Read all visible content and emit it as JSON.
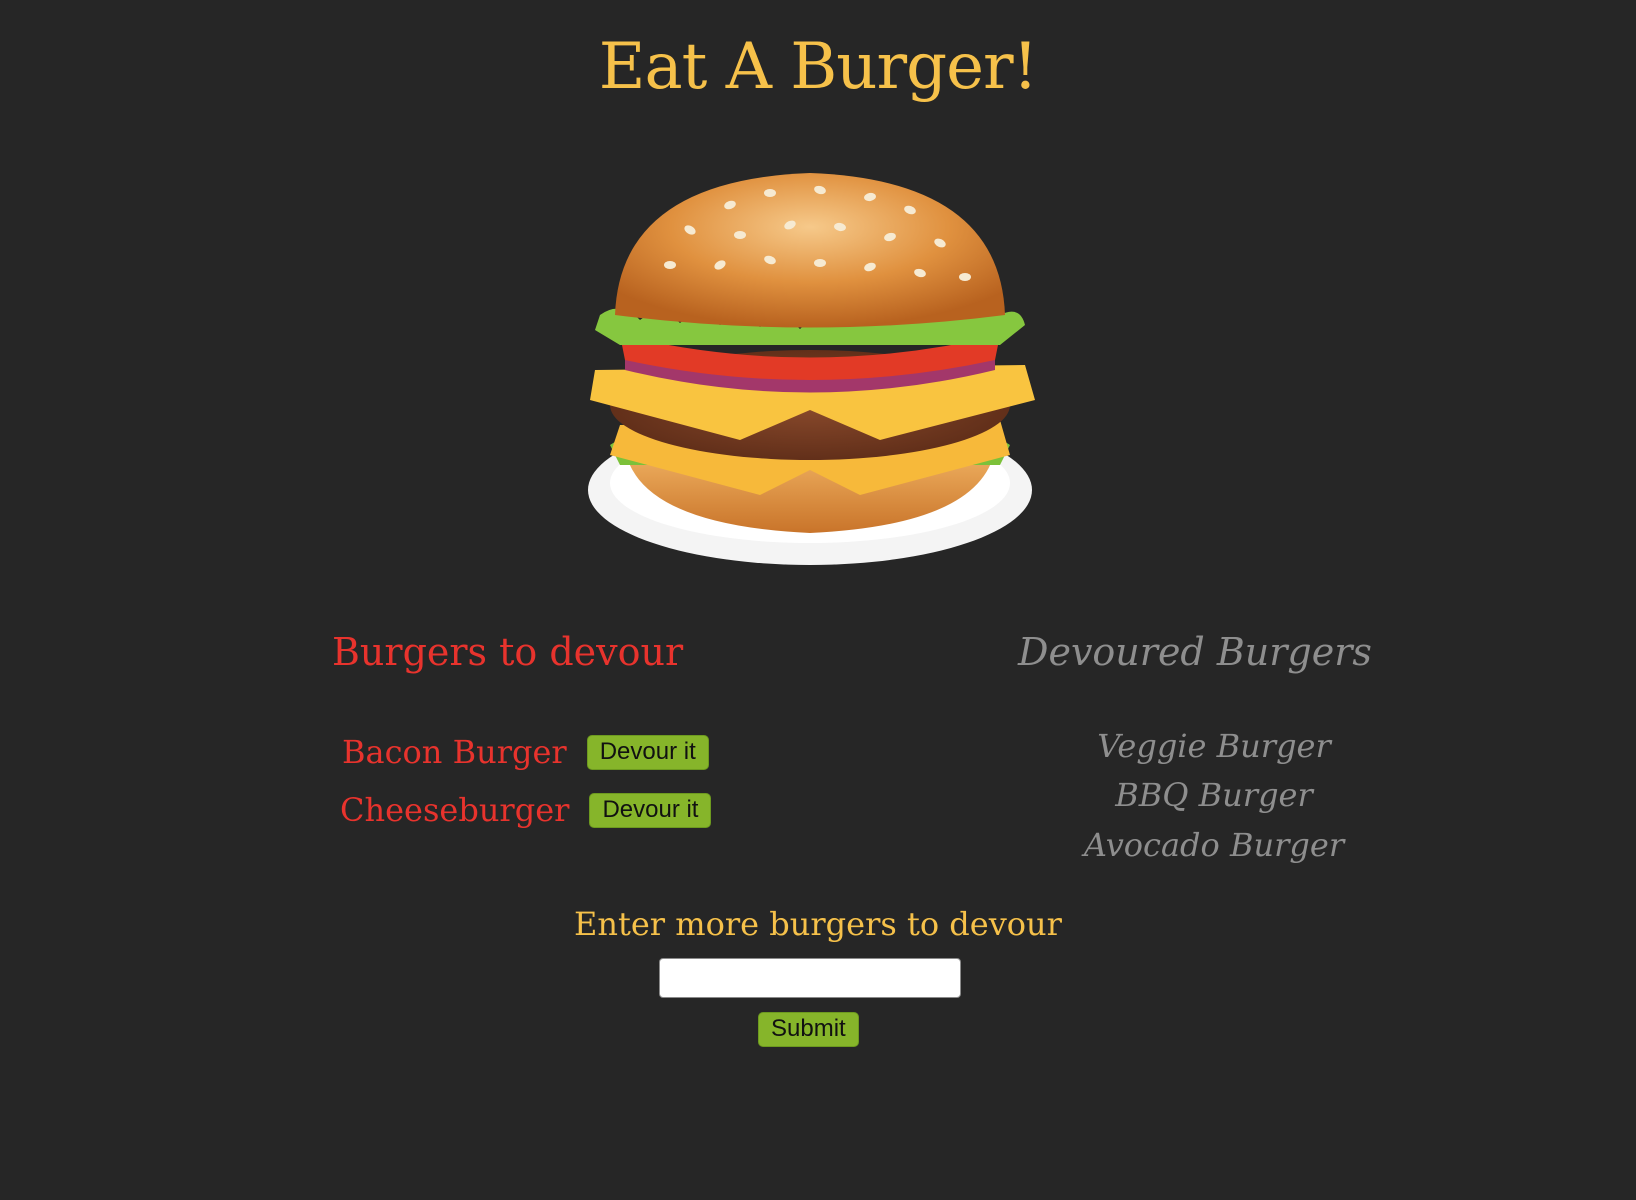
{
  "header": {
    "title": "Eat A Burger!"
  },
  "hero": {
    "image_name": "burger-illustration"
  },
  "to_devour": {
    "heading": "Burgers to devour",
    "items": [
      {
        "name": "Bacon Burger",
        "button_label": "Devour it"
      },
      {
        "name": "Cheeseburger",
        "button_label": "Devour it"
      }
    ]
  },
  "devoured": {
    "heading": "Devoured Burgers",
    "items": [
      "Veggie Burger",
      "BBQ Burger",
      "Avocado Burger"
    ]
  },
  "form": {
    "label": "Enter more burgers to devour",
    "input_value": "",
    "submit_label": "Submit"
  },
  "colors": {
    "background": "#262626",
    "title": "#f6c14a",
    "to_devour": "#e8332d",
    "devoured": "#8e8e8e",
    "button": "#86b52a"
  }
}
